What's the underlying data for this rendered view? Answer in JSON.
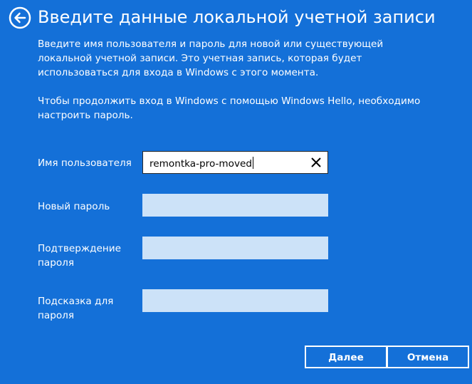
{
  "header": {
    "title": "Введите данные локальной учетной записи",
    "back_icon": "back-arrow-circle-icon"
  },
  "description": {
    "paragraph1": "Введите имя пользователя и пароль для новой или существующей локальной учетной записи. Это учетная запись, которая будет использоваться для входа в Windows с этого момента.",
    "paragraph2": "Чтобы продолжить вход в Windows с помощью Windows Hello, необходимо настроить пароль."
  },
  "form": {
    "username": {
      "label": "Имя пользователя",
      "value": "remontka-pro-moved",
      "clear_icon": "close-icon"
    },
    "new_password": {
      "label": "Новый пароль",
      "value": ""
    },
    "confirm_password": {
      "label": "Подтверждение пароля",
      "value": ""
    },
    "password_hint": {
      "label": "Подсказка для пароля",
      "value": ""
    }
  },
  "buttons": {
    "next_label": "Далее",
    "cancel_label": "Отмена"
  },
  "colors": {
    "background": "#1470d8",
    "text": "#ffffff",
    "input_inactive": "#cce2f8",
    "input_active": "#ffffff"
  }
}
